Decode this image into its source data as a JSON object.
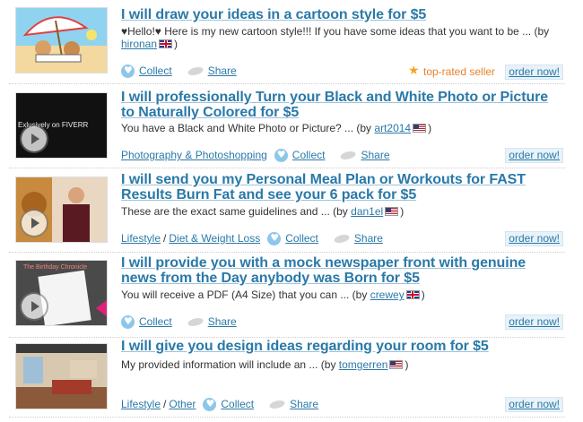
{
  "gigs": [
    {
      "title": "I will draw your ideas in a cartoon style for $5",
      "desc_prefix": "♥Hello!♥ Here is my new cartoon style!!! If you have some ideas that you want to be ...  (by",
      "seller": "hironan",
      "desc_suffix": ")",
      "collect": "Collect",
      "share": "Share",
      "badge": "top-rated seller",
      "order": "order now!"
    },
    {
      "title": "I will professionally Turn your Black and White Photo or Picture to Naturally Colored for $5",
      "thumb_text": "Exlusively on FIVERR",
      "desc_prefix": "You have a Black and White Photo or Picture? ...  (by",
      "seller": "art2014",
      "desc_suffix": ")",
      "category": "Photography & Photoshopping",
      "collect": "Collect",
      "share": "Share",
      "order": "order now!"
    },
    {
      "title": "I will send you my Personal Meal Plan or Workouts for FAST Results Burn Fat and see your 6 pack for $5",
      "desc_prefix": "These are the exact same guidelines and ...  (by",
      "seller": "dan1el",
      "desc_suffix": ")",
      "category": "Lifestyle",
      "subcategory": "Diet & Weight Loss",
      "collect": "Collect",
      "share": "Share",
      "order": "order now!"
    },
    {
      "title": "I will provide you with a mock newspaper front with genuine news from the Day anybody was Born for $5",
      "thumb_text": "The Birthday Chronicle",
      "desc_prefix": "You will receive a PDF (A4 Size) that you can ...  (by",
      "seller": "crewey",
      "desc_suffix": ")",
      "collect": "Collect",
      "share": "Share",
      "order": "order now!"
    },
    {
      "title": "I will give you design ideas regarding your room for $5",
      "desc_prefix": "My provided information will include an ...  (by",
      "seller": "tomgerren",
      "desc_suffix": ")",
      "category": "Lifestyle",
      "subcategory": "Other",
      "collect": "Collect",
      "share": "Share",
      "order": "order now!"
    }
  ]
}
